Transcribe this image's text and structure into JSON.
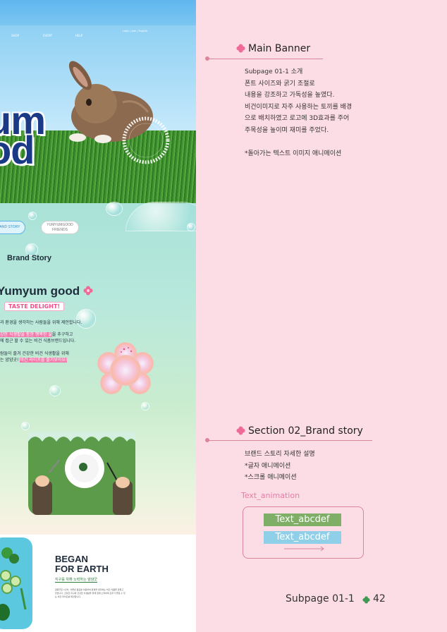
{
  "screenshot": {
    "nav": {
      "items": [
        "SHOP",
        "EVENT",
        "HELP"
      ],
      "util": "Login | Join | English"
    },
    "banner": {
      "big_text_1": "um",
      "big_text_2": "od"
    },
    "story": {
      "pill_left": "AND STORY",
      "pill_right_1": "YUMYUMGOOD",
      "pill_right_2": "FRIENDS",
      "title": "Brand Story",
      "brand_name": "Yumyum good",
      "taste": "TASTE DELIGHT!",
      "line1": "과 환경을 생각하는 사람들을 위해 제안합니다.",
      "line2a": "강한 식생활을 통한 행복한 삶",
      "line2b": "을 추구하고",
      "line3": "에 접근 할 수 있는 비건 식품브랜드입니다.",
      "line4": "람들이 즐겨 건강한 비건 식생활을 위해",
      "line5a": "는 얌얌굿!",
      "line5b": "비건 라이프를 즐겨보아요!"
    },
    "earth": {
      "title_1": "BEGAN",
      "title_2": "FOR EARTH",
      "subtitle": "지구를 위해 노력하는 얌얌굿",
      "body": "얌얌굿은 1인식, 식물성 원료를 이용하여 환경을 생각하는 비건 식품을 만들고 있습니다. 건강한 지구와 건강한 식생활을 위해 함께 노력하며 모두가 즐길 수 있는 비건 라이프를 제안합니다."
    }
  },
  "annotations": {
    "main_banner": {
      "title": "Main Banner",
      "desc": "Subpage 01-1 소개\n폰트 사이즈와 굵기 조절로\n내용을 강조하고 가독성을 높였다.\n비건이미지로 자주 사용하는 토끼를 배경\n으로 배치하였고 로고에 3D효과를 주어\n주목성을 높이며 재미를 주었다.\n\n*돌아가는 텍스트 이미지 애니메이션"
    },
    "brand_story": {
      "title": "Section 02_Brand story",
      "desc": "브랜드 스토리 자세한 설명\n*글자 애니메이션\n*스크롤 애니메이션"
    },
    "text_animation": {
      "label": "Text_animation",
      "sample_1": "Text_abcdef",
      "sample_2": "Text_abcdef"
    }
  },
  "footer": {
    "page_label": "Subpage 01-1",
    "page_number": "42"
  },
  "colors": {
    "page_bg": "#fcdde6",
    "accent_pink": "#e97aa5",
    "line_pink": "#d9869a",
    "clover_pink": "#f06a97",
    "clover_green": "#3f9a52",
    "anim_green": "#7fae66",
    "anim_blue": "#8fd0e8"
  },
  "icons": [
    "clover-icon",
    "flower-icon",
    "rotating-text-ring",
    "arrow-right-icon"
  ]
}
